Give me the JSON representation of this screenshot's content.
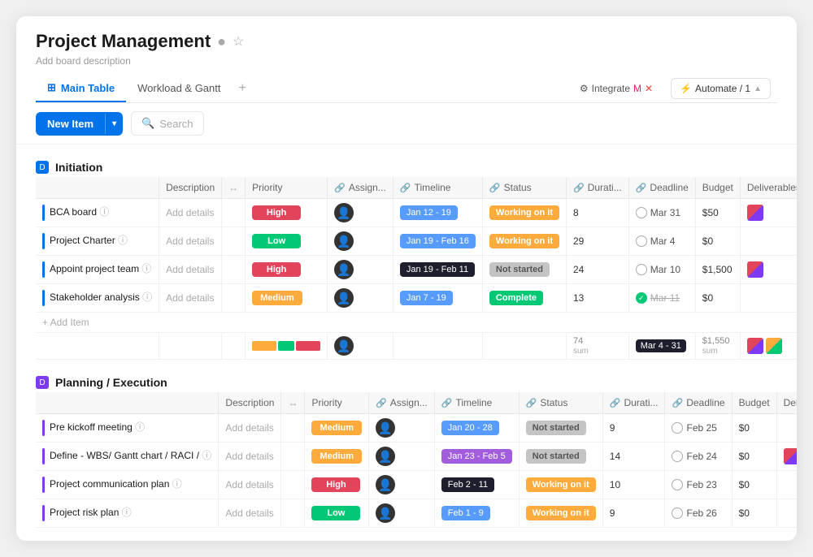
{
  "app": {
    "title": "Project Management",
    "add_desc": "Add board description"
  },
  "tabs": {
    "items": [
      {
        "label": "Main Table",
        "icon": "⊞",
        "active": true
      },
      {
        "label": "Workload & Gantt",
        "icon": "📊",
        "active": false
      }
    ],
    "add_label": "+",
    "right": {
      "integrate": "Integrate",
      "automate": "Automate / 1"
    }
  },
  "toolbar": {
    "new_item": "New Item",
    "search": "Search"
  },
  "sections": [
    {
      "id": "initiation",
      "title": "Initiation",
      "color": "blue",
      "columns": [
        "Description",
        "Priority",
        "Assign...",
        "Timeline",
        "Status",
        "Durati...",
        "Deadline",
        "Budget",
        "Deliverables"
      ],
      "rows": [
        {
          "name": "BCA board",
          "description": "Add details",
          "priority": "High",
          "priority_class": "p-high",
          "timeline": "Jan 12 - 19",
          "timeline_class": "timeline-badge",
          "status": "Working on it",
          "status_class": "s-working",
          "duration": "8",
          "deadline": "Mar 31",
          "deadline_done": false,
          "budget": "$50",
          "deliverable": true,
          "del_colors": [
            "#e2445c",
            "#7e3af2"
          ]
        },
        {
          "name": "Project Charter",
          "description": "Add details",
          "priority": "Low",
          "priority_class": "p-low",
          "timeline": "Jan 19 - Feb 16",
          "timeline_class": "timeline-badge",
          "status": "Working on it",
          "status_class": "s-working",
          "duration": "29",
          "deadline": "Mar 4",
          "deadline_done": false,
          "budget": "$0",
          "deliverable": false
        },
        {
          "name": "Appoint project team",
          "description": "Add details",
          "priority": "High",
          "priority_class": "p-high",
          "timeline": "Jan 19 - Feb 11",
          "timeline_class": "timeline-badge dark",
          "status": "Not started",
          "status_class": "s-not-started",
          "duration": "24",
          "deadline": "Mar 10",
          "deadline_done": false,
          "budget": "$1,500",
          "deliverable": true,
          "del_colors": [
            "#e2445c",
            "#7e3af2"
          ]
        },
        {
          "name": "Stakeholder analysis",
          "description": "Add details",
          "priority": "Medium",
          "priority_class": "p-medium",
          "timeline": "Jan 7 - 19",
          "timeline_class": "timeline-badge",
          "status": "Complete",
          "status_class": "s-complete",
          "duration": "13",
          "deadline": "Mar 11",
          "deadline_done": true,
          "budget": "$0",
          "deliverable": false
        }
      ],
      "add_item": "+ Add Item",
      "sum": {
        "duration_total": "74",
        "duration_label": "sum",
        "deadline_range": "Mar 4 - 31",
        "budget_total": "$1,550",
        "budget_label": "sum",
        "bars": [
          {
            "color": "#fdab3d",
            "width": 30
          },
          {
            "color": "#00c875",
            "width": 20
          },
          {
            "color": "#e2445c",
            "width": 30
          }
        ]
      }
    },
    {
      "id": "planning",
      "title": "Planning / Execution",
      "color": "purple",
      "columns": [
        "Description",
        "Priority",
        "Assign...",
        "Timeline",
        "Status",
        "Durati...",
        "Deadline",
        "Budget",
        "Deliverables"
      ],
      "rows": [
        {
          "name": "Pre kickoff meeting",
          "description": "Add details",
          "priority": "Medium",
          "priority_class": "p-medium",
          "timeline": "Jan 20 - 28",
          "timeline_class": "timeline-badge",
          "status": "Not started",
          "status_class": "s-not-started",
          "duration": "9",
          "deadline": "Feb 25",
          "deadline_done": false,
          "budget": "$0",
          "deliverable": false
        },
        {
          "name": "Define - WBS/ Gantt chart / RACI /",
          "description": "Add details",
          "priority": "Medium",
          "priority_class": "p-medium",
          "timeline": "Jan 23 - Feb 5",
          "timeline_class": "timeline-badge purple",
          "status": "Not started",
          "status_class": "s-not-started",
          "duration": "14",
          "deadline": "Feb 24",
          "deadline_done": false,
          "budget": "$0",
          "deliverable": true,
          "del_colors": [
            "#e2445c",
            "#7e3af2"
          ]
        },
        {
          "name": "Project communication plan",
          "description": "Add details",
          "priority": "High",
          "priority_class": "p-high",
          "timeline": "Feb 2 - 11",
          "timeline_class": "timeline-badge dark",
          "status": "Working on it",
          "status_class": "s-working",
          "duration": "10",
          "deadline": "Feb 23",
          "deadline_done": false,
          "budget": "$0",
          "deliverable": false
        },
        {
          "name": "Project risk plan",
          "description": "Add details",
          "priority": "Low",
          "priority_class": "p-low",
          "timeline": "Feb 1 - 9",
          "timeline_class": "timeline-badge",
          "status": "Working on it",
          "status_class": "s-working",
          "duration": "9",
          "deadline": "Feb 26",
          "deadline_done": false,
          "budget": "$0",
          "deliverable": false
        }
      ]
    }
  ]
}
